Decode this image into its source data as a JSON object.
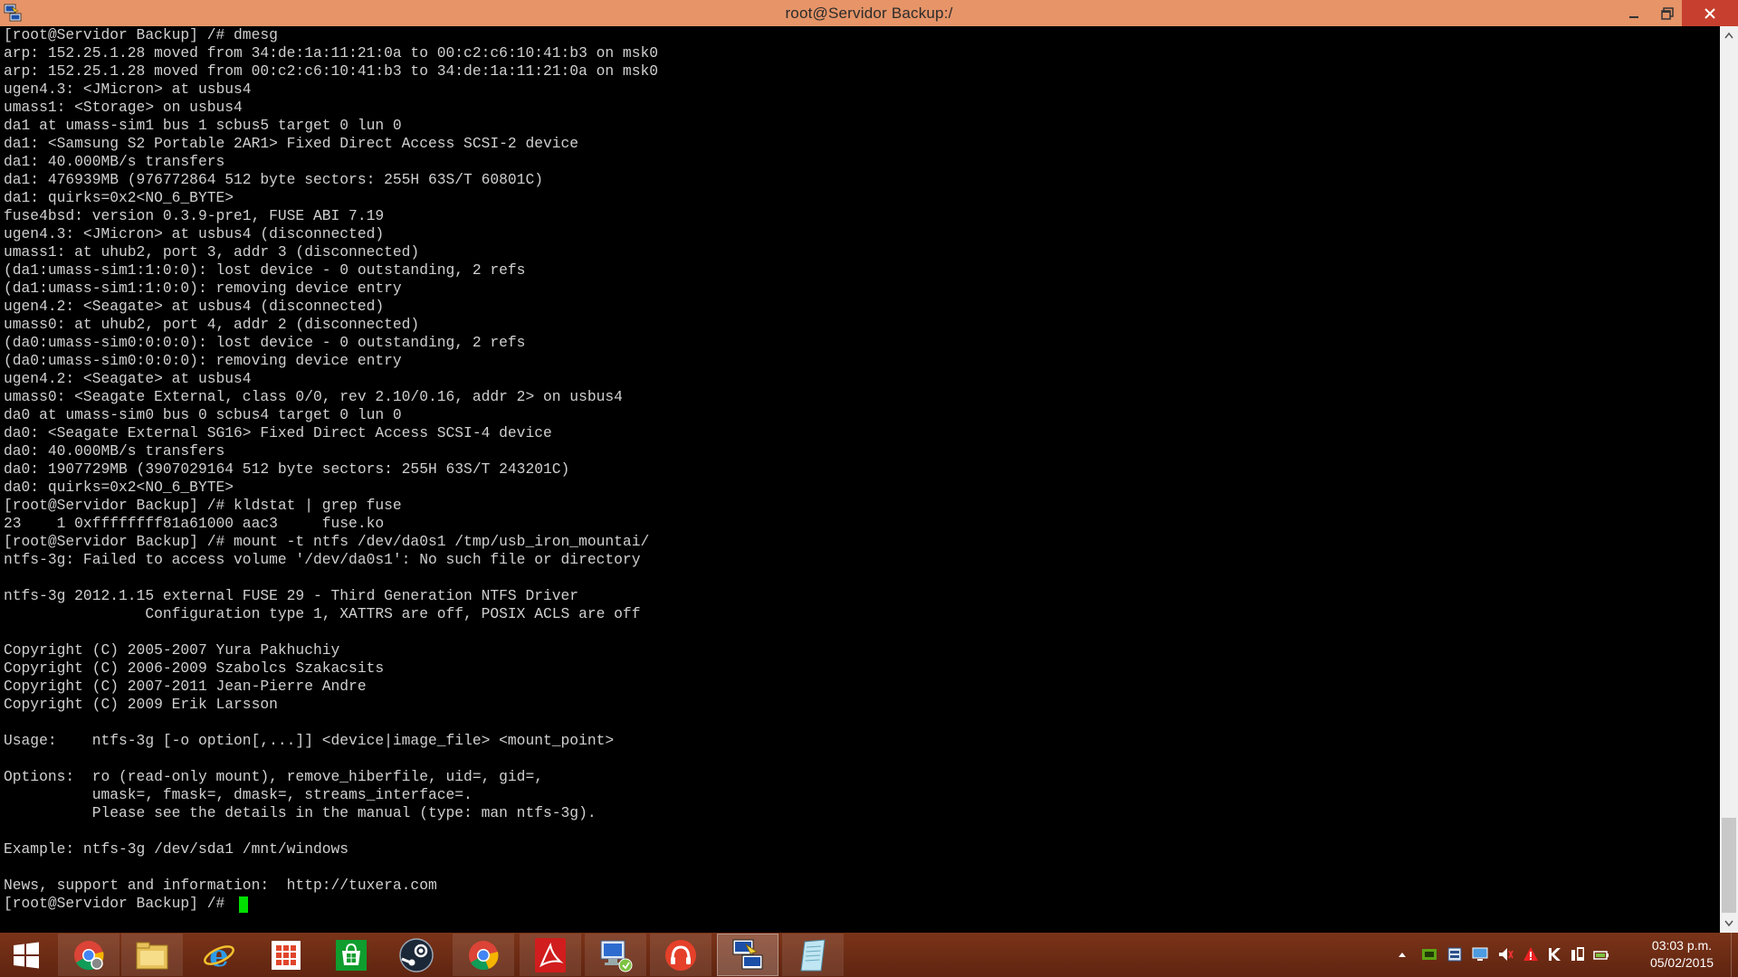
{
  "window": {
    "title": "root@Servidor Backup:/"
  },
  "terminal": {
    "lines": [
      "[root@Servidor Backup] /# dmesg",
      "arp: 152.25.1.28 moved from 34:de:1a:11:21:0a to 00:c2:c6:10:41:b3 on msk0",
      "arp: 152.25.1.28 moved from 00:c2:c6:10:41:b3 to 34:de:1a:11:21:0a on msk0",
      "ugen4.3: <JMicron> at usbus4",
      "umass1: <Storage> on usbus4",
      "da1 at umass-sim1 bus 1 scbus5 target 0 lun 0",
      "da1: <Samsung S2 Portable 2AR1> Fixed Direct Access SCSI-2 device",
      "da1: 40.000MB/s transfers",
      "da1: 476939MB (976772864 512 byte sectors: 255H 63S/T 60801C)",
      "da1: quirks=0x2<NO_6_BYTE>",
      "fuse4bsd: version 0.3.9-pre1, FUSE ABI 7.19",
      "ugen4.3: <JMicron> at usbus4 (disconnected)",
      "umass1: at uhub2, port 3, addr 3 (disconnected)",
      "(da1:umass-sim1:1:0:0): lost device - 0 outstanding, 2 refs",
      "(da1:umass-sim1:1:0:0): removing device entry",
      "ugen4.2: <Seagate> at usbus4 (disconnected)",
      "umass0: at uhub2, port 4, addr 2 (disconnected)",
      "(da0:umass-sim0:0:0:0): lost device - 0 outstanding, 2 refs",
      "(da0:umass-sim0:0:0:0): removing device entry",
      "ugen4.2: <Seagate> at usbus4",
      "umass0: <Seagate External, class 0/0, rev 2.10/0.16, addr 2> on usbus4",
      "da0 at umass-sim0 bus 0 scbus4 target 0 lun 0",
      "da0: <Seagate External SG16> Fixed Direct Access SCSI-4 device",
      "da0: 40.000MB/s transfers",
      "da0: 1907729MB (3907029164 512 byte sectors: 255H 63S/T 243201C)",
      "da0: quirks=0x2<NO_6_BYTE>",
      "[root@Servidor Backup] /# kldstat | grep fuse",
      "23    1 0xffffffff81a61000 aac3     fuse.ko",
      "[root@Servidor Backup] /# mount -t ntfs /dev/da0s1 /tmp/usb_iron_mountai/",
      "ntfs-3g: Failed to access volume '/dev/da0s1': No such file or directory",
      "",
      "ntfs-3g 2012.1.15 external FUSE 29 - Third Generation NTFS Driver",
      "                Configuration type 1, XATTRS are off, POSIX ACLS are off",
      "",
      "Copyright (C) 2005-2007 Yura Pakhuchiy",
      "Copyright (C) 2006-2009 Szabolcs Szakacsits",
      "Copyright (C) 2007-2011 Jean-Pierre Andre",
      "Copyright (C) 2009 Erik Larsson",
      "",
      "Usage:    ntfs-3g [-o option[,...]] <device|image_file> <mount_point>",
      "",
      "Options:  ro (read-only mount), remove_hiberfile, uid=, gid=,",
      "          umask=, fmask=, dmask=, streams_interface=.",
      "          Please see the details in the manual (type: man ntfs-3g).",
      "",
      "Example: ntfs-3g /dev/sda1 /mnt/windows",
      "",
      "News, support and information:  http://tuxera.com",
      "[root@Servidor Backup] /# "
    ]
  },
  "taskbar": {
    "apps": [
      {
        "icon": "start-icon"
      },
      {
        "icon": "chrome-icon"
      },
      {
        "icon": "file-explorer-icon"
      },
      {
        "icon": "internet-explorer-icon"
      },
      {
        "icon": "apps-grid-icon"
      },
      {
        "icon": "store-icon"
      },
      {
        "icon": "steam-icon"
      },
      {
        "icon": "chrome-icon"
      },
      {
        "icon": "acrobat-icon"
      },
      {
        "icon": "remote-desktop-icon"
      },
      {
        "icon": "headphones-icon"
      },
      {
        "icon": "putty-icon"
      },
      {
        "icon": "notepad-icon"
      }
    ],
    "clock": {
      "time": "03:03 p.m.",
      "date": "05/02/2015"
    }
  },
  "colors": {
    "titlebar": "#e69468",
    "close_button": "#c7402f",
    "taskbar": "#6e2c14",
    "cursor": "#00e000",
    "terminal_text": "#d0d0d0"
  }
}
